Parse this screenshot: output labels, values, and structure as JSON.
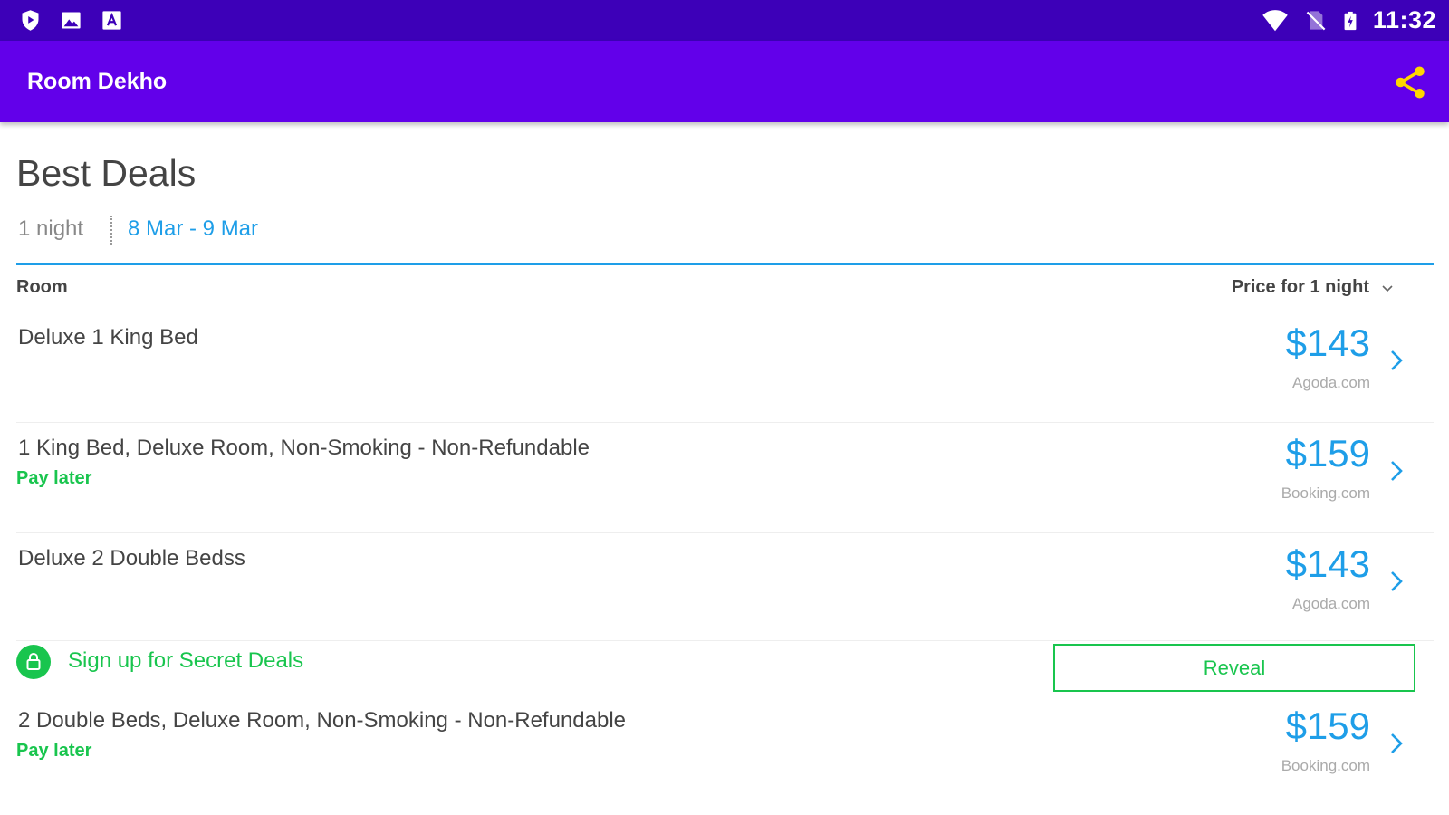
{
  "status_bar": {
    "time": "11:32",
    "left_icons": [
      "shield-play-icon",
      "image-icon",
      "font-a-icon"
    ],
    "right_icons": [
      "wifi-icon",
      "no-sim-icon",
      "battery-icon"
    ]
  },
  "app_bar": {
    "title": "Room Dekho",
    "share_icon": "share-icon",
    "share_color": "#ffd600"
  },
  "section": {
    "title": "Best Deals",
    "nights": "1 night",
    "dates": "8 Mar - 9 Mar"
  },
  "table": {
    "col_room": "Room",
    "col_price": "Price for 1 night",
    "rows": [
      {
        "name": "Deluxe 1 King Bed",
        "pay_later": "",
        "price": "$143",
        "source": "Agoda.com"
      },
      {
        "name": "1 King Bed, Deluxe Room, Non-Smoking - Non-Refundable",
        "pay_later": "Pay later",
        "price": "$159",
        "source": "Booking.com"
      },
      {
        "name": "Deluxe 2 Double Bedss",
        "pay_later": "",
        "price": "$143",
        "source": "Agoda.com"
      },
      {
        "name": "2 Double Beds, Deluxe Room, Non-Smoking - Non-Refundable",
        "pay_later": "Pay later",
        "price": "$159",
        "source": "Booking.com"
      }
    ]
  },
  "secret_deals": {
    "label": "Sign up for Secret Deals",
    "button": "Reveal",
    "icon": "lock-icon"
  },
  "colors": {
    "status_bar": "#3d00b8",
    "app_bar": "#6200ea",
    "accent_blue": "#1e9ee8",
    "accent_green": "#19c54e"
  }
}
